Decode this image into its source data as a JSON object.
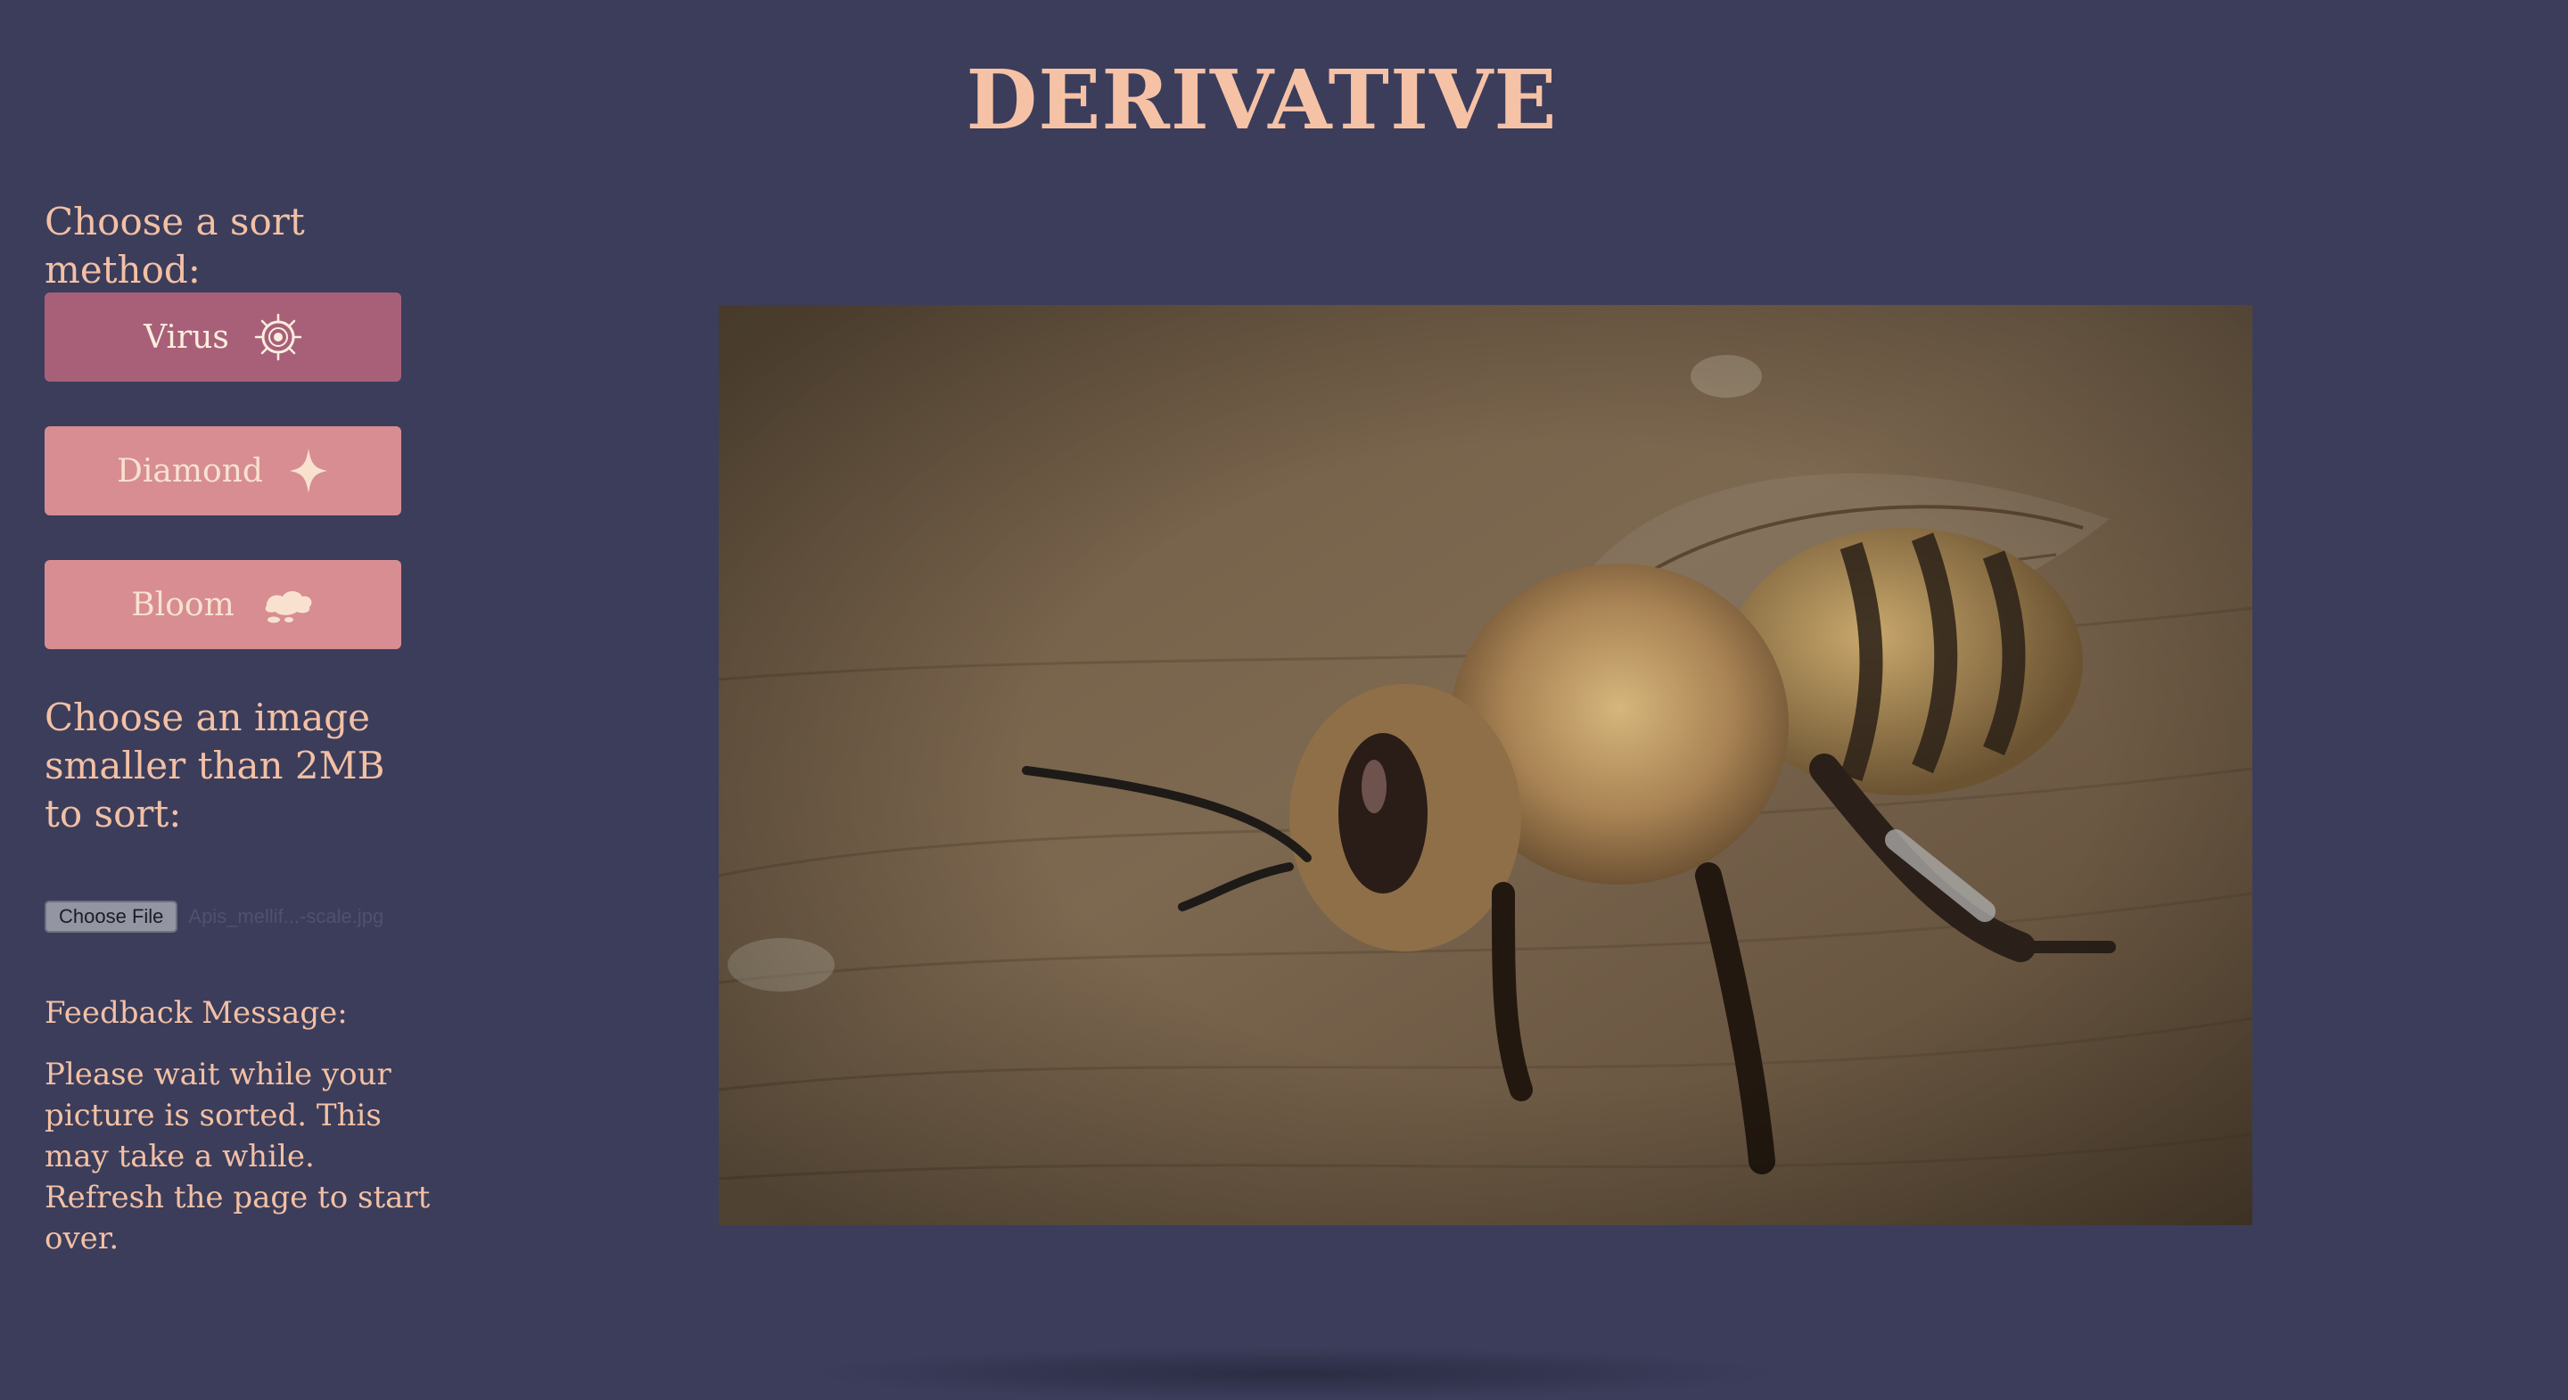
{
  "app": {
    "title": "DERIVATIVE"
  },
  "sidebar": {
    "sort_heading": "Choose a sort method:",
    "buttons": [
      {
        "label": "Virus",
        "icon": "virus-icon",
        "selected": true
      },
      {
        "label": "Diamond",
        "icon": "diamond-icon",
        "selected": false
      },
      {
        "label": "Bloom",
        "icon": "bloom-icon",
        "selected": false
      }
    ],
    "image_heading": "Choose an image smaller than 2MB to sort:",
    "file_input": {
      "button_label": "Choose File",
      "file_name": "Apis_mellif...-scale.jpg"
    },
    "feedback_label": "Feedback Message:",
    "feedback_message": "Please wait while your picture is sorted. This may take a while. Refresh the page to start over."
  },
  "colors": {
    "background": "#3b3d5b",
    "title_text": "#f6c2a6",
    "button_selected": "#a86079",
    "button_default": "#d78d92"
  }
}
